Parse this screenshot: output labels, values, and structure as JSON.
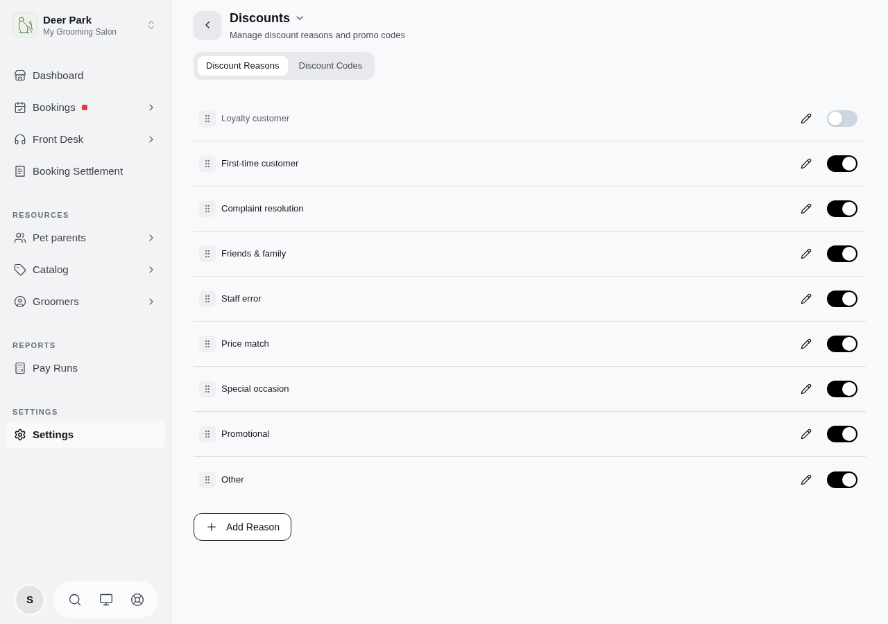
{
  "sidebar": {
    "workspace": {
      "name": "Deer Park",
      "subtitle": "My Grooming Salon"
    },
    "sections": [
      {
        "items": [
          {
            "label": "Dashboard",
            "has_submenu": false,
            "notification": false,
            "selected": false
          },
          {
            "label": "Bookings",
            "has_submenu": true,
            "notification": true,
            "selected": false
          },
          {
            "label": "Front Desk",
            "has_submenu": true,
            "notification": false,
            "selected": false
          },
          {
            "label": "Booking Settlement",
            "has_submenu": false,
            "notification": false,
            "selected": false
          }
        ]
      },
      {
        "heading": "RESOURCES",
        "items": [
          {
            "label": "Pet parents",
            "has_submenu": true,
            "notification": false,
            "selected": false
          },
          {
            "label": "Catalog",
            "has_submenu": true,
            "notification": false,
            "selected": false
          },
          {
            "label": "Groomers",
            "has_submenu": true,
            "notification": false,
            "selected": false
          }
        ]
      },
      {
        "heading": "REPORTS",
        "items": [
          {
            "label": "Pay Runs",
            "has_submenu": false,
            "notification": false,
            "selected": false
          }
        ]
      },
      {
        "heading": "SETTINGS",
        "items": [
          {
            "label": "Settings",
            "has_submenu": false,
            "notification": false,
            "selected": true
          }
        ]
      }
    ],
    "user": {
      "initial": "S"
    }
  },
  "page": {
    "title": "Discounts",
    "subtitle": "Manage discount reasons and promo codes"
  },
  "tabs": [
    {
      "label": "Discount Reasons",
      "selected": true
    },
    {
      "label": "Discount Codes",
      "selected": false
    }
  ],
  "reasons": [
    {
      "label": "Loyalty customer",
      "on": false
    },
    {
      "label": "First-time customer",
      "on": true
    },
    {
      "label": "Complaint resolution",
      "on": true
    },
    {
      "label": "Friends & family",
      "on": true
    },
    {
      "label": "Staff error",
      "on": true
    },
    {
      "label": "Price match",
      "on": true
    },
    {
      "label": "Special occasion",
      "on": true
    },
    {
      "label": "Promotional",
      "on": true
    },
    {
      "label": "Other",
      "on": true
    }
  ],
  "add_button": {
    "label": "Add Reason"
  }
}
